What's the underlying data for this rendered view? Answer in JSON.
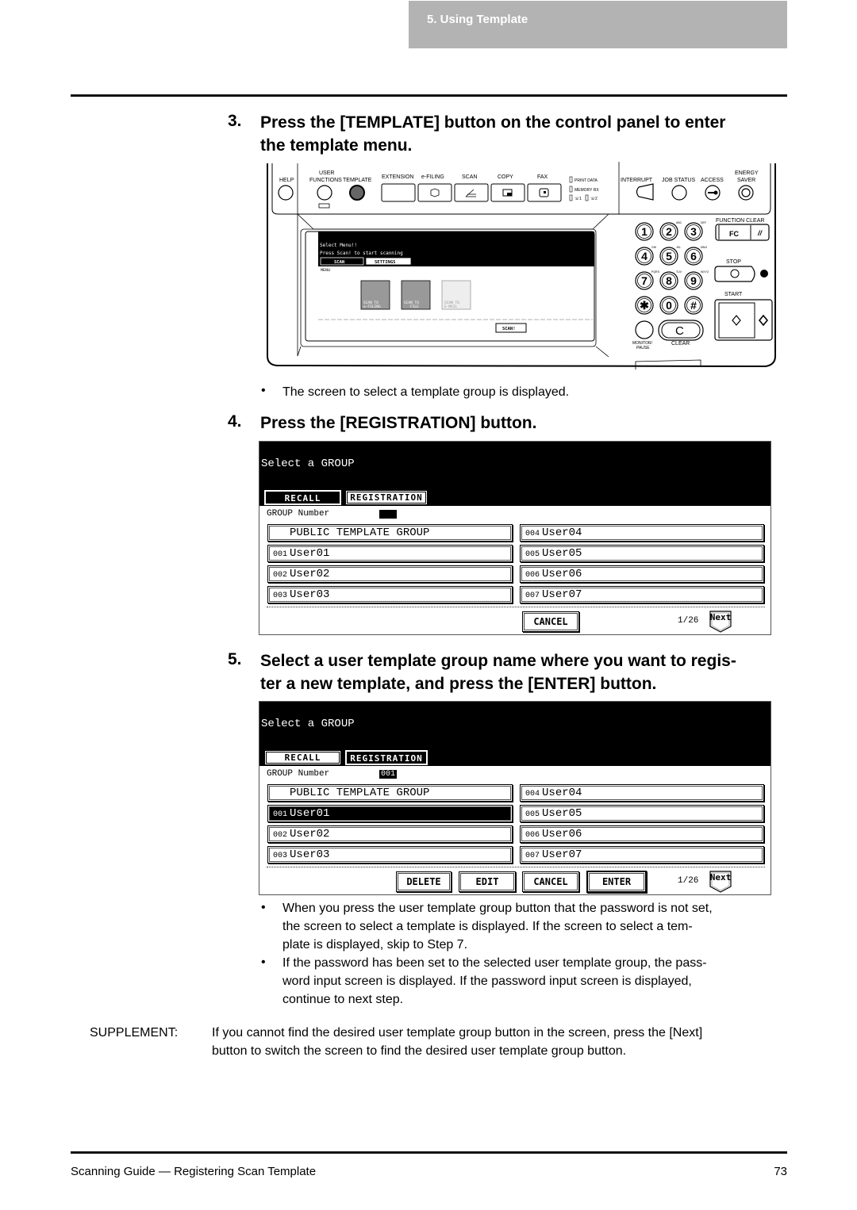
{
  "header": {
    "chapter": "5. Using Template"
  },
  "steps": [
    {
      "number": "3.",
      "lines": [
        "Press the [TEMPLATE] button on the control panel to enter",
        "the template menu."
      ],
      "bullets": [
        "The screen to select a template group is displayed."
      ]
    },
    {
      "number": "4.",
      "lines": [
        "Press the [REGISTRATION] button."
      ]
    },
    {
      "number": "5.",
      "lines": [
        "Select a user template group name where you want to regis-",
        "ter a new template, and press the [ENTER] button."
      ],
      "bullets": [
        [
          "When you press the user template group button that the password is not set,",
          "the screen to select a template is displayed.  If the screen to select a tem-",
          "plate is displayed, skip to Step 7."
        ],
        [
          "If the password has been set to the selected user template group, the pass-",
          "word input screen is displayed.  If the password input screen is displayed,",
          "continue to next step."
        ]
      ]
    }
  ],
  "control_panel": {
    "buttons": {
      "help": "HELP",
      "user_functions": [
        "USER",
        "FUNCTIONS"
      ],
      "template": "TEMPLATE",
      "extension": "EXTENSION",
      "efiling": "e-FILING",
      "scan": "SCAN",
      "copy": "COPY",
      "fax": "FAX",
      "interrupt": "INTERRUPT",
      "job_status": "JOB STATUS",
      "access": "ACCESS",
      "energy_saver": [
        "ENERGY",
        "SAVER"
      ],
      "function_clear": "FUNCTION CLEAR",
      "fc": "FC",
      "stop": "STOP",
      "start": "START",
      "monitor_pause": [
        "MONITOR/",
        "PAUSE"
      ],
      "clear": "CLEAR",
      "clear_key": "C"
    },
    "indicators": [
      "PRINT DATA",
      "MEMORY RX",
      "1",
      "2"
    ],
    "keypad": [
      {
        "key": "1",
        "sub": ""
      },
      {
        "key": "2",
        "sub": "ABC"
      },
      {
        "key": "3",
        "sub": "DEF"
      },
      {
        "key": "4",
        "sub": "GHI"
      },
      {
        "key": "5",
        "sub": "JKL"
      },
      {
        "key": "6",
        "sub": "MNO"
      },
      {
        "key": "7",
        "sub": "PQRS"
      },
      {
        "key": "8",
        "sub": "TUV"
      },
      {
        "key": "9",
        "sub": "WXYZ"
      },
      {
        "key": "✱",
        "sub": ""
      },
      {
        "key": "0",
        "sub": ""
      },
      {
        "key": "#",
        "sub": ""
      }
    ],
    "lcd": {
      "line1": "Select Menu!!",
      "line2": "Press Scan! to start scanning",
      "tab_scan": "SCAN",
      "tab_settings": "SETTINGS",
      "menu_label": "MENU",
      "icons": [
        {
          "label1": "SCAN TO",
          "label2": "e-FILING"
        },
        {
          "label1": "SCAN TO",
          "label2": "FILE"
        },
        {
          "label1": "SCAN TO",
          "label2": "E-MAIL"
        }
      ],
      "scan_button": "SCAN!"
    }
  },
  "screen_registration": {
    "title": "Select a GROUP",
    "tab_recall": "RECALL",
    "tab_registration": "REGISTRATION",
    "group_number_label": "GROUP Number",
    "group_number_value": "",
    "public_group": "PUBLIC TEMPLATE GROUP",
    "groups": [
      {
        "num": "001",
        "name": "User01"
      },
      {
        "num": "002",
        "name": "User02"
      },
      {
        "num": "003",
        "name": "User03"
      },
      {
        "num": "004",
        "name": "User04"
      },
      {
        "num": "005",
        "name": "User05"
      },
      {
        "num": "006",
        "name": "User06"
      },
      {
        "num": "007",
        "name": "User07"
      }
    ],
    "cancel": "CANCEL",
    "page": "1/26",
    "next": "Next"
  },
  "screen_select": {
    "title": "Select a GROUP",
    "tab_recall": "RECALL",
    "tab_registration": "REGISTRATION",
    "group_number_label": "GROUP Number",
    "group_number_value": "001",
    "public_group": "PUBLIC TEMPLATE GROUP",
    "groups": [
      {
        "num": "001",
        "name": "User01"
      },
      {
        "num": "002",
        "name": "User02"
      },
      {
        "num": "003",
        "name": "User03"
      },
      {
        "num": "004",
        "name": "User04"
      },
      {
        "num": "005",
        "name": "User05"
      },
      {
        "num": "006",
        "name": "User06"
      },
      {
        "num": "007",
        "name": "User07"
      }
    ],
    "selected_group": "001",
    "delete": "DELETE",
    "edit": "EDIT",
    "cancel": "CANCEL",
    "enter": "ENTER",
    "page": "1/26",
    "next": "Next"
  },
  "supplement": {
    "label": "SUPPLEMENT:",
    "lines": [
      "If you cannot find the desired user template group button in the screen, press the [Next]",
      "button to switch the screen to find the desired user template group button."
    ]
  },
  "footer": {
    "title": "Scanning Guide — Registering Scan Template",
    "page": "73"
  }
}
